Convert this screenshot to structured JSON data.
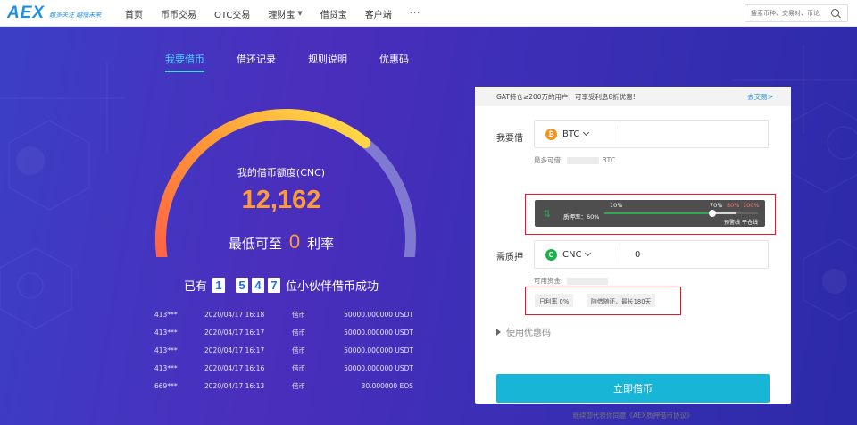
{
  "header": {
    "logo": "AEX",
    "slogan": "越多关注 越懂未来",
    "nav": [
      {
        "label": "首页"
      },
      {
        "label": "币币交易"
      },
      {
        "label": "OTC交易"
      },
      {
        "label": "理财宝",
        "has_caret": true
      },
      {
        "label": "借贷宝"
      },
      {
        "label": "客户端"
      }
    ],
    "more": "···",
    "search_placeholder": "搜索币种、交易对、币论"
  },
  "tabs": [
    {
      "label": "我要借币",
      "active": true
    },
    {
      "label": "借还记录"
    },
    {
      "label": "规则说明"
    },
    {
      "label": "优惠码"
    }
  ],
  "hero": {
    "title": "我的借币额度(CNC)",
    "amount": "12,162",
    "rate_prefix": "最低可至",
    "rate_value": "0",
    "rate_suffix": "利率",
    "success_prefix": "已有",
    "success_digits": [
      "1",
      "5",
      "4",
      "7"
    ],
    "success_suffix": "位小伙伴借币成功",
    "gauge_fill_fraction": 0.68,
    "colors": {
      "gauge_start": "#ff5a46",
      "gauge_mid": "#ff9a36",
      "gauge_end": "#ffe34a",
      "gauge_rest": "#8b86d6",
      "amount": "#ff9b3b"
    }
  },
  "records": [
    {
      "user": "413***",
      "time": "2020/04/17 16:18",
      "type": "借币",
      "amount": "50000.000000 USDT"
    },
    {
      "user": "413***",
      "time": "2020/04/17 16:17",
      "type": "借币",
      "amount": "50000.000000 USDT"
    },
    {
      "user": "413***",
      "time": "2020/04/17 16:17",
      "type": "借币",
      "amount": "50000.000000 USDT"
    },
    {
      "user": "413***",
      "time": "2020/04/17 16:16",
      "type": "借币",
      "amount": "50000.000000 USDT"
    },
    {
      "user": "669***",
      "time": "2020/04/17 16:13",
      "type": "借币",
      "amount": "30.000000 EOS"
    }
  ],
  "form": {
    "notice": "GAT持仓≥200万的用户，可享受利息8折优惠!",
    "notice_link": "去交易>",
    "borrow_label": "我要借",
    "borrow_coin": "BTC",
    "borrow_coin_icon": "btc-icon",
    "max_borrow_prefix": "最多可借:",
    "max_borrow_unit": "BTC",
    "slider": {
      "ratio_label": "质押率：60%",
      "current": 60,
      "mark_10": "10%",
      "mark_70": "70%",
      "mark_80": "80%",
      "mark_100": "100%",
      "warn_label": "预警线",
      "liquidate_label": "平仓线"
    },
    "collateral_label": "需质押",
    "collateral_coin": "CNC",
    "collateral_coin_icon": "cnc-icon",
    "collateral_value": "0",
    "available_prefix": "可用资金:",
    "tag_rate": "日利率 0%",
    "tag_term": "随借随还，最长180天",
    "coupon": "使用优惠码",
    "submit": "立即借币",
    "agree": "继续即代表你同意《AEX质押借币协议》"
  }
}
